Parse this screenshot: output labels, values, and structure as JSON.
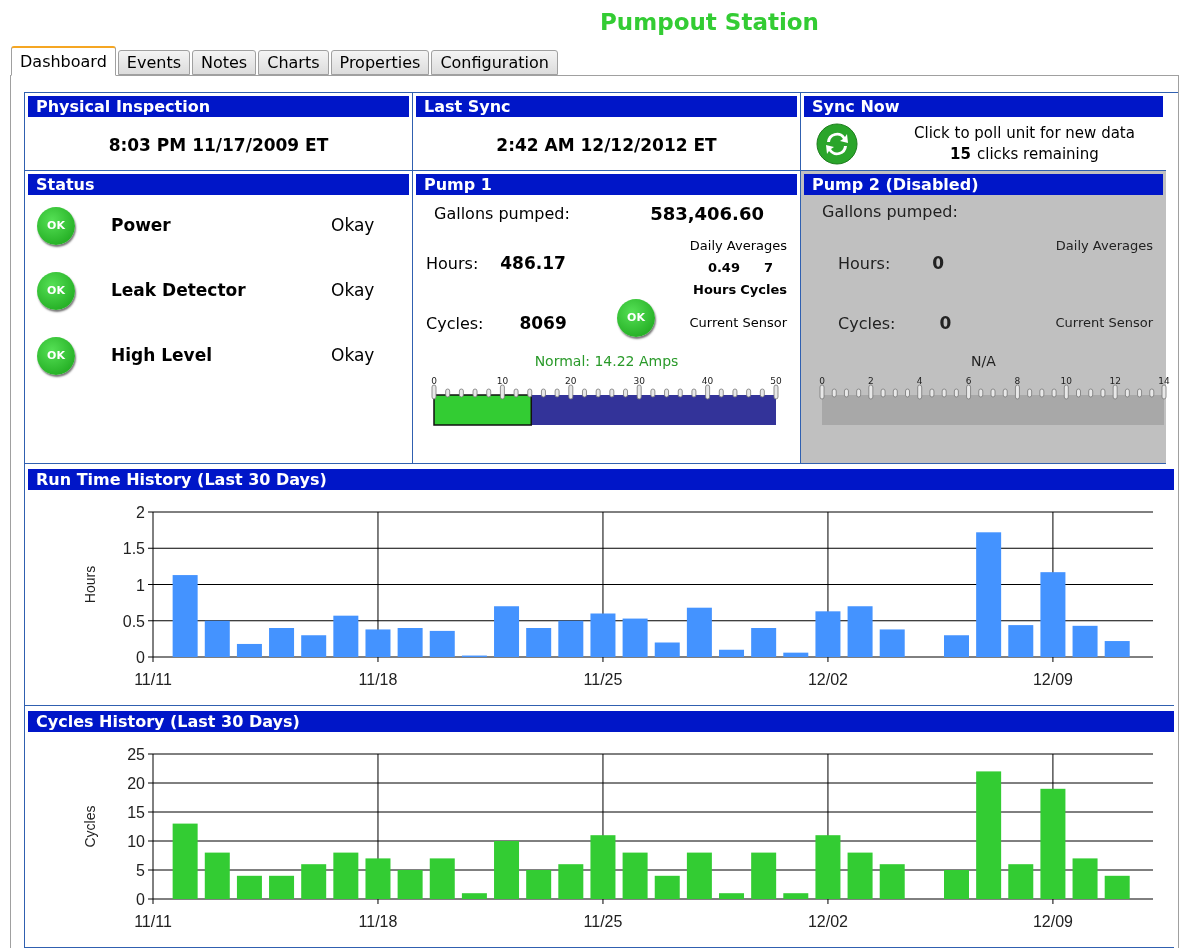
{
  "title": "Pumpout Station",
  "tabs": [
    {
      "label": "Dashboard",
      "selected": true
    },
    {
      "label": "Events",
      "selected": false
    },
    {
      "label": "Notes",
      "selected": false
    },
    {
      "label": "Charts",
      "selected": false
    },
    {
      "label": "Properties",
      "selected": false
    },
    {
      "label": "Configuration",
      "selected": false
    }
  ],
  "physical_inspection": {
    "header": "Physical Inspection",
    "value": "8:03 PM 11/17/2009 ET"
  },
  "last_sync": {
    "header": "Last Sync",
    "value": "2:42 AM 12/12/2012 ET"
  },
  "sync_now": {
    "header": "Sync Now",
    "message": "Click to poll unit for new data",
    "clicks_remaining": "15",
    "clicks_label": "clicks remaining"
  },
  "status": {
    "header": "Status",
    "items": [
      {
        "badge": "OK",
        "label": "Power",
        "state": "Okay"
      },
      {
        "badge": "OK",
        "label": "Leak Detector",
        "state": "Okay"
      },
      {
        "badge": "OK",
        "label": "High Level",
        "state": "Okay"
      }
    ]
  },
  "pumps": [
    {
      "header": "Pump 1",
      "disabled": false,
      "gallons_label": "Gallons pumped:",
      "gallons": "583,406.60",
      "hours_label": "Hours:",
      "hours": "486.17",
      "cycles_label": "Cycles:",
      "cycles": "8069",
      "daily_averages_label": "Daily Averages",
      "avg_hours": "0.49",
      "avg_cycles": "7",
      "avg_hours_label": "Hours",
      "avg_cycles_label": "Cycles",
      "sensor_badge": "OK",
      "sensor_label": "Current Sensor",
      "reading": "Normal: 14.22 Amps",
      "gauge": {
        "level": 0.2844,
        "ticks": [
          "0",
          "10",
          "20",
          "30",
          "40",
          "50"
        ]
      }
    },
    {
      "header": "Pump 2 (Disabled)",
      "disabled": true,
      "gallons_label": "Gallons pumped:",
      "hours_label": "Hours:",
      "hours": "0",
      "cycles_label": "Cycles:",
      "cycles": "0",
      "daily_averages_label": "Daily Averages",
      "sensor_label": "Current Sensor",
      "reading": "N/A",
      "gauge": {
        "ticks": [
          "0",
          "2",
          "4",
          "6",
          "8",
          "10",
          "12",
          "14"
        ]
      }
    }
  ],
  "charts": [
    {
      "chart_data": {
        "type": "bar",
        "title": "Run Time History (Last 30 Days)",
        "ylabel": "Hours",
        "grid": true,
        "ylim": [
          0,
          2
        ],
        "yticks": [
          {
            "value": 0,
            "label": "0"
          },
          {
            "value": 0.5,
            "label": "0.5"
          },
          {
            "value": 1,
            "label": "1"
          },
          {
            "value": 1.5,
            "label": "1.5"
          },
          {
            "value": 2,
            "label": "2"
          }
        ],
        "categories": [
          "11/11",
          null,
          null,
          null,
          null,
          null,
          null,
          "11/18",
          null,
          null,
          null,
          null,
          null,
          null,
          "11/25",
          null,
          null,
          null,
          null,
          null,
          null,
          "12/02",
          null,
          null,
          null,
          null,
          null,
          null,
          "12/09",
          null,
          null
        ],
        "series": [
          {
            "color": "#4493ff",
            "values": [
              null,
              1.13,
              0.5,
              0.18,
              0.4,
              0.3,
              0.57,
              0.38,
              0.4,
              0.36,
              0.02,
              0.7,
              0.4,
              0.5,
              0.6,
              0.53,
              0.2,
              0.68,
              0.1,
              0.4,
              0.06,
              0.63,
              0.7,
              0.38,
              null,
              0.3,
              1.72,
              0.44,
              1.17,
              0.43,
              0.22
            ]
          }
        ]
      }
    },
    {
      "chart_data": {
        "type": "bar",
        "title": "Cycles History (Last 30 Days)",
        "ylabel": "Cycles",
        "grid": true,
        "ylim": [
          0,
          25
        ],
        "yticks": [
          {
            "value": 0,
            "label": "0"
          },
          {
            "value": 5,
            "label": "5"
          },
          {
            "value": 10,
            "label": "10"
          },
          {
            "value": 15,
            "label": "15"
          },
          {
            "value": 20,
            "label": "20"
          },
          {
            "value": 25,
            "label": "25"
          }
        ],
        "categories": [
          "11/11",
          null,
          null,
          null,
          null,
          null,
          null,
          "11/18",
          null,
          null,
          null,
          null,
          null,
          null,
          "11/25",
          null,
          null,
          null,
          null,
          null,
          null,
          "12/02",
          null,
          null,
          null,
          null,
          null,
          null,
          "12/09",
          null,
          null
        ],
        "series": [
          {
            "color": "#33cc33",
            "values": [
              null,
              13,
              8,
              4,
              4,
              6,
              8,
              7,
              5,
              7,
              1,
              10,
              5,
              6,
              11,
              8,
              4,
              8,
              1,
              8,
              1,
              11,
              8,
              6,
              null,
              5,
              22,
              6,
              19,
              7,
              4
            ]
          }
        ]
      }
    }
  ]
}
